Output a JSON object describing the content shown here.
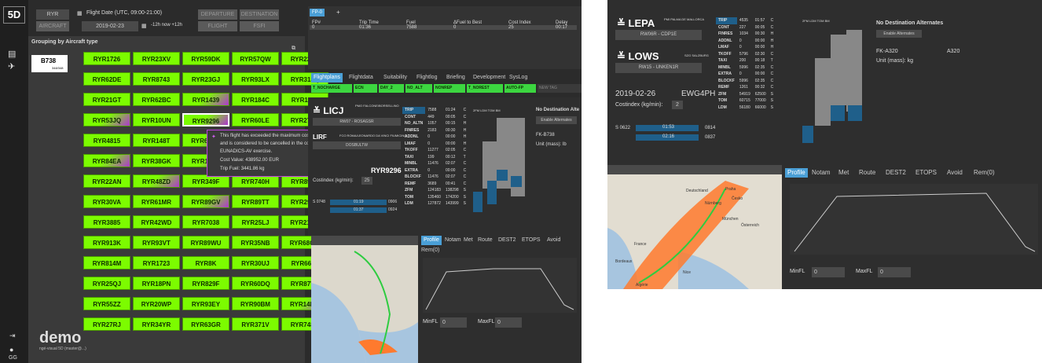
{
  "header": {
    "logo": "5D",
    "airline": "RYR",
    "aircraft_btn": "AIRCRAFT",
    "date_label": "Flight Date (UTC, 09:00-21:00)",
    "date": "2019-02-23",
    "time_range": "-12h  now  +12h",
    "departure_btn": "DEPARTURE",
    "destination_btn": "DESTINATION",
    "flight_btn": "FLIGHT",
    "fsfi_btn": "FSFI"
  },
  "grouping": {
    "title": "Grouping by Aircraft type",
    "type": "B738",
    "count": "348/348"
  },
  "flights": [
    "RYR1726",
    "RYR23XV",
    "RYR59DK",
    "RYR57QW",
    "RYR22XU",
    "RYR62DE",
    "RYR8743",
    "RYR23GJ",
    "RYR93LX",
    "RYR318Q",
    "RYR21GT",
    "RYR62BC",
    "RYR1439",
    "RYR184C",
    "RYR1413",
    "RYR53JQ",
    "RYR10UN",
    "RYR9296",
    "RYR60LE",
    "RYR27DE",
    "RYR4815",
    "RYR148T",
    "RYR60GC",
    "RYR49PB",
    "RYR61KL",
    "RYR84EA",
    "RYR38GK",
    "RYR15TD",
    "RYR33BG",
    "RYR88VD",
    "RYR22AN",
    "RYR48ZD",
    "RYR349F",
    "RYR740H",
    "RYR890A",
    "RYR30VA",
    "RYR61MR",
    "RYR89GV",
    "RYR89TT",
    "RYR294Q",
    "RYR3885",
    "RYR42WD",
    "RYR7038",
    "RYR25LJ",
    "RYR21MX",
    "RYR913K",
    "RYR93VT",
    "RYR89WU",
    "RYR35NB",
    "RYR68CW",
    "RYR814M",
    "RYR1723",
    "RYR8K",
    "RYR30UJ",
    "RYR664F",
    "RYR25QJ",
    "RYR18PN",
    "RYR829F",
    "RYR60DQ",
    "RYR87VR",
    "RYR55ZZ",
    "RYR20WP",
    "RYR93EY",
    "RYR90BM",
    "RYR14DM",
    "RYR27RJ",
    "RYR34YR",
    "RYR63GR",
    "RYR371V",
    "RYR748M"
  ],
  "tooltip": {
    "line1": "This flight has exceeded the maximum cost threshold",
    "line2": "and is considered to be cancelled in the context of the",
    "line3": "EUNADICS-AV exercise.",
    "cost": "Cost Value: 438952.00 EUR",
    "fuel": "Trip Fuel: 3441.86 kg"
  },
  "watermark": "demo",
  "watermark_sub": "ngé-visual 5D (master@...)",
  "user": "GG",
  "fp_table": {
    "tab": "FP-0",
    "headers": [
      "FP#",
      "Trip Time",
      "Fuel",
      "ΔFuel to Best",
      "Cost Index",
      "Delay"
    ],
    "row": [
      "0",
      "01:36",
      "7588",
      "0",
      "25",
      "00:17"
    ]
  },
  "main_tabs": [
    "Flightplans",
    "Flightdata",
    "Suitability",
    "Flightlog",
    "Briefing",
    "Development",
    "SysLog"
  ],
  "tags": [
    "T_NOCHARGE",
    "ECN",
    "DAY_2",
    "NO_ALT",
    "NONREP",
    "T_NOREST",
    "AUTO-FP",
    "NEW TAG"
  ],
  "fp_detail": {
    "dest": "LICJ",
    "dest_name": "PMO FALCONE/BORSELLINO",
    "runway": "RW07 - ROSAGSR",
    "alt": "LIRF",
    "alt_name": "FCO ROMA/LEONARDO DA VINCI FIUMICINO",
    "alt_rwy": "DOSBULTW",
    "flight": "RYR9296",
    "costindex_label": "Costindex (kg/min):",
    "costindex": "25",
    "s_label": "S 0748",
    "s_time": "01:19",
    "s_val": "0906",
    "s2_time": "01:37",
    "s2_val": "0924",
    "no_dest_alt": "No Destination Alte",
    "enable_alt": "Enable Alternates",
    "fk": "FK-B738",
    "unit": "Unit (mass): lb"
  },
  "fuel_rows": [
    [
      "TRIP",
      "7588",
      "01:24",
      "C"
    ],
    [
      "CONT",
      "449",
      "00:05",
      "C"
    ],
    [
      "NO_ALTN",
      "1057",
      "00:15",
      "H"
    ],
    [
      "FINRES",
      "2183",
      "00:30",
      "H"
    ],
    [
      "ADDNL",
      "0",
      "00:00",
      "H"
    ],
    [
      "LMAF",
      "0",
      "00:00",
      "H"
    ],
    [
      "TKOFF",
      "11277",
      "02:05",
      "C"
    ],
    [
      "TAXI",
      "199",
      "00:12",
      "T"
    ],
    [
      "MINBL",
      "11476",
      "02:07",
      "C"
    ],
    [
      "EXTRA",
      "0",
      "00:00",
      "C"
    ],
    [
      "BLOCKF",
      "11476",
      "02:07",
      "C"
    ],
    [
      "REMF",
      "3689",
      "00:41",
      "C"
    ],
    [
      "ZFM",
      "124183",
      "138298",
      "S"
    ],
    [
      "TOM",
      "135460",
      "174200",
      "S"
    ],
    [
      "LDM",
      "127872",
      "143999",
      "S"
    ]
  ],
  "bar_labels": [
    "2FM",
    "LDM",
    "TOM",
    "BM"
  ],
  "profile_tabs": [
    "Profile",
    "Notam",
    "Met",
    "Route",
    "DEST2",
    "ETOPS",
    "Avoid",
    "Rem(0)"
  ],
  "minfl_label": "MinFL",
  "minfl": "0",
  "maxfl_label": "MaxFL",
  "maxfl": "0",
  "right_panel": {
    "dep": "LEPA",
    "dep_name": "PMI PALMA DE MALLORCA",
    "dep_rwy": "RW06R - CDP1E",
    "arr": "LOWS",
    "arr_name": "SZG SALZBURG",
    "arr_rwy": "RW15 - UNKEN1R",
    "date": "2019-02-26",
    "reg": "EWG4PH",
    "costindex_label": "Costindex (kg/min):",
    "costindex": "2",
    "s_label": "S 0622",
    "s_time": "01:53",
    "s_val": "0814",
    "s2_time": "02:16",
    "s2_val": "0837",
    "no_dest_alt": "No Destination Alternates",
    "enable_alt": "Enable Alternates",
    "fk": "FK-A320",
    "ac": "A320",
    "unit": "Unit (mass): kg"
  },
  "right_fuel_rows": [
    [
      "TRIP",
      "4535",
      "01:57",
      "C"
    ],
    [
      "CONT",
      "227",
      "00:05",
      "C"
    ],
    [
      "FINRES",
      "1034",
      "00:30",
      "H"
    ],
    [
      "ADDNL",
      "0",
      "00:00",
      "H"
    ],
    [
      "LMAF",
      "0",
      "00:00",
      "H"
    ],
    [
      "TKOFF",
      "5796",
      "02:30",
      "C"
    ],
    [
      "TAXI",
      "200",
      "00:18",
      "T"
    ],
    [
      "MINBL",
      "5996",
      "02:35",
      "C"
    ],
    [
      "EXTRA",
      "0",
      "00:00",
      "C"
    ],
    [
      "BLOCKF",
      "5996",
      "02:35",
      "C"
    ],
    [
      "REMF",
      "1261",
      "00:32",
      "C"
    ],
    [
      "ZFM",
      "54919",
      "62500",
      "S"
    ],
    [
      "TOM",
      "60715",
      "77000",
      "S"
    ],
    [
      "LDM",
      "56180",
      "66000",
      "S"
    ]
  ],
  "map_labels": {
    "germany": "Deutschland",
    "austria": "Österreich",
    "nurnberg": "Nürnberg",
    "praha": "Praha",
    "ceska": "Česko",
    "munchen": "München",
    "france": "France",
    "bordeaux": "Bordeaux",
    "nice": "Nice",
    "algerie": "Algérie"
  }
}
